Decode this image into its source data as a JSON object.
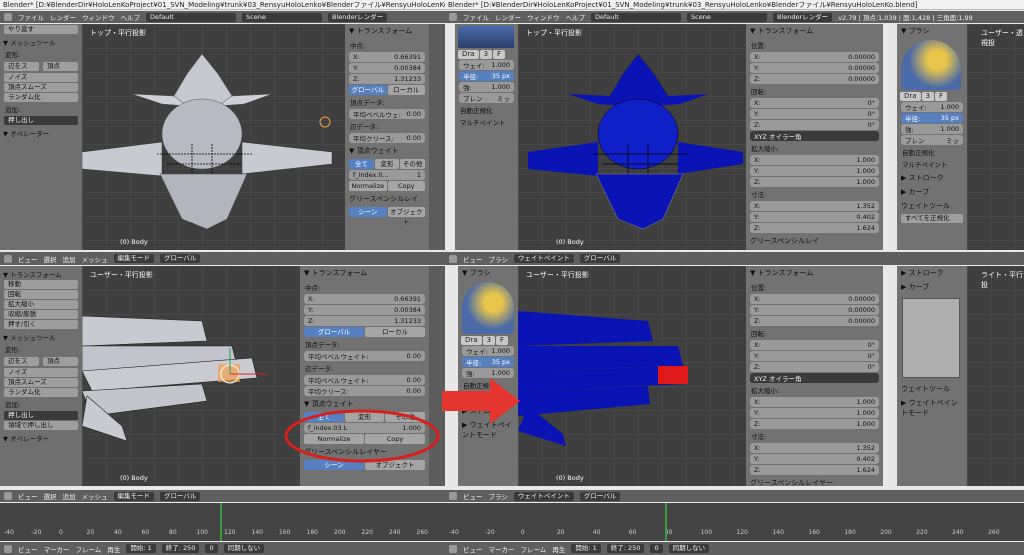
{
  "left_window": {
    "title": "Blender* [D:¥BlenderDir¥HoloLenKoProject¥01_SVN_Modeling¥trunk¥03_RensyuHoloLenko¥Blenderファイル¥RensyuHoloLenKo.blend]",
    "menu": [
      "ファイル",
      "レンダー",
      "ウィンドウ",
      "ヘルプ"
    ],
    "layout": "Default",
    "scene": "Scene",
    "engine": "Blenderレンダー"
  },
  "right_window": {
    "title": "Blender* [D:¥BlenderDir¥HoloLenKoProject¥01_SVN_Modeling¥trunk¥03_RensyuHoloLenko¥Blenderファイル¥RensyuHoloLenKo.blend]",
    "menu": [
      "ファイル",
      "レンダー",
      "ウィンドウ",
      "ヘルプ"
    ],
    "layout": "Default",
    "scene": "Scene",
    "engine": "Blenderレンダー",
    "stats": "v2.79 | 頂点:1,039 | 面:1,428 | 三角面:1,99"
  },
  "tools": {
    "redo": "やり直す",
    "mesh_tools": "▼ メッシュツール",
    "deform": "変形:",
    "slide_edge": "辺をス",
    "vertex": "頂点",
    "noise": "ノイズ",
    "smooth_vertex": "頂点スムーズ",
    "randomize": "ランダム化",
    "add": "追加:",
    "extrude": "押し出し",
    "operator": "▼ オペレーター",
    "transform": "▼ トランスフォーム",
    "move": "移動",
    "rotate": "回転",
    "scale": "拡大縮小",
    "shrink": "収縮/膨張",
    "push_pull": "押す/引く",
    "extrude_region": "領域で押し出し"
  },
  "views": {
    "top_left_title": "トップ・平行投影",
    "top_right_title": "トップ・平行投影",
    "bottom_left_title": "ユーザー・平行投影",
    "bottom_right_title": "ユーザー・平行投影",
    "far_right_top_title": "ユーザー・透視投",
    "far_right_bottom_title": "ライト・平行投",
    "object": "(0) Body"
  },
  "header_bar": {
    "view": "ビュー",
    "select": "選択",
    "add": "追加",
    "mesh": "メッシュ",
    "edit_mode": "編集モード",
    "weight_paint": "ウェイトペイント",
    "global": "グローバル",
    "brush": "ブラシ"
  },
  "props": {
    "transform": "▼ トランスフォーム",
    "median": "中点:",
    "x_label": "X:",
    "x": "0.66391",
    "y_label": "Y:",
    "y": "0.00384",
    "z_label": "Z:",
    "z": "1.31233",
    "global": "グローバル",
    "local": "ローカル",
    "vertex_data": "頂点データ:",
    "mean_bevel_weight": "平均ベベルウェイト:",
    "mean_bevel_weight_short": "平均ベベルウェ:",
    "bevel_val": "0.00",
    "edge_data": "辺データ:",
    "mean_crease": "平均クリース:",
    "crease_val": "0.00",
    "vertex_weights": "▼ 頂点ウェイト",
    "all": "全て",
    "deform": "変形",
    "other": "その他",
    "group_name": "f_index.03.L",
    "group_name_short": "f_index.0...",
    "group_weight": "1.000",
    "group_weight_short": "1",
    "normalize": "Normalize",
    "copy": "Copy",
    "grease_pencil": "グリースペンシルレイヤー",
    "grease_pencil_short": "グリースペンシルレイ",
    "scene": "シーン",
    "object": "オブジェクト"
  },
  "obj_props": {
    "transform": "▼ トランスフォーム",
    "location": "位置:",
    "lx": "0.00000",
    "ly": "0.00000",
    "lz": "0.00000",
    "rotation": "回転:",
    "rx": "0°",
    "ry": "0°",
    "rz": "0°",
    "rot_mode": "XYZ オイラー角",
    "scale": "拡大縮小:",
    "sx": "1.000",
    "sy": "1.000",
    "sz": "1.000",
    "dimensions": "寸法:",
    "dx": "1.352",
    "dy": "0.402",
    "dz": "1.624",
    "grease_pencil": "グリースペンシルレイ",
    "grease_pencil_full": "グリースペンシルレイヤー"
  },
  "brush_panel": {
    "brush": "▼ ブラシ",
    "brush_name": "Dra",
    "users": "3",
    "f": "F",
    "weight_label": "ウェイ:",
    "weight": "1.000",
    "radius_label": "半径:",
    "radius": "35 px",
    "strength_label": "強:",
    "strength": "1.000",
    "blend_label": "ブレン",
    "blend": "ミッ",
    "auto_normalize": "自動正規化",
    "multi_paint": "マルチペイント",
    "stroke": "▶ ストローク",
    "curve": "▶ カーブ",
    "weight_tools": "ウェイトツール",
    "normalize_all": "すべてを正規化",
    "weight_paint_mode": "▶ ウェイトペイントモード"
  },
  "timeline": {
    "view": "ビュー",
    "marker": "マーカー",
    "frame": "フレーム",
    "playback": "再生",
    "start_label": "開始:",
    "start": "1",
    "end_label": "終了:",
    "end": "250",
    "current": "0",
    "sync": "同期しない",
    "ticks": [
      "-40",
      "-20",
      "0",
      "20",
      "40",
      "60",
      "80",
      "100",
      "120",
      "140",
      "160",
      "180",
      "200",
      "220",
      "240",
      "260"
    ]
  },
  "colors": {
    "accent_blue": "#5680c2",
    "weight_blue": "#0a14b4",
    "red_arrow": "#e4352e",
    "highlight_ring": "#d52020"
  }
}
